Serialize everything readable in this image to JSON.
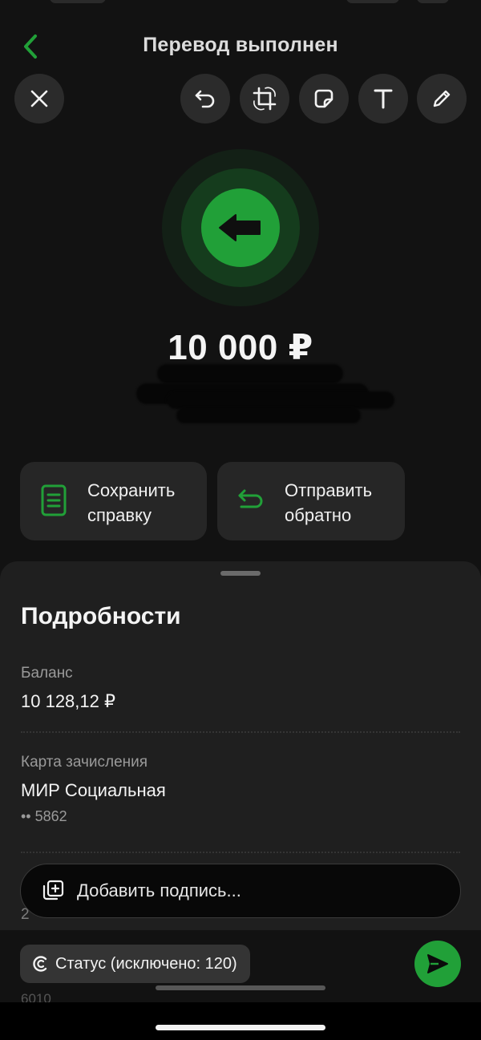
{
  "header": {
    "title": "Перевод выполнен",
    "back_icon": "chevron-left-icon"
  },
  "toolbar": {
    "close_icon": "close-icon",
    "undo_icon": "undo-icon",
    "crop_icon": "crop-rotate-icon",
    "sticker_icon": "sticker-icon",
    "text_icon": "text-icon",
    "draw_icon": "pencil-icon"
  },
  "hero": {
    "icon": "arrow-left-icon",
    "amount": "10 000 ₽"
  },
  "actions": {
    "save": {
      "line1": "Сохранить",
      "line2": "справку",
      "icon": "document-icon"
    },
    "return": {
      "line1": "Отправить",
      "line2": "обратно",
      "icon": "return-arrow-icon"
    }
  },
  "details": {
    "title": "Подробности",
    "balance_label": "Баланс",
    "balance_value": "10 128,12 ₽",
    "card_label": "Карта зачисления",
    "card_name": "МИР Социальная",
    "card_number": "•• 5862",
    "peek_text": "2",
    "bottom_peek": "6010"
  },
  "caption": {
    "placeholder": "Добавить подпись...",
    "icon": "add-media-icon"
  },
  "status_chip": {
    "label": "Статус (исключено: 120)",
    "icon": "status-c-icon"
  },
  "send": {
    "icon": "send-icon"
  },
  "colors": {
    "accent": "#21a038",
    "background": "#121212",
    "card": "#262626",
    "sheet": "#1f1f1f"
  }
}
